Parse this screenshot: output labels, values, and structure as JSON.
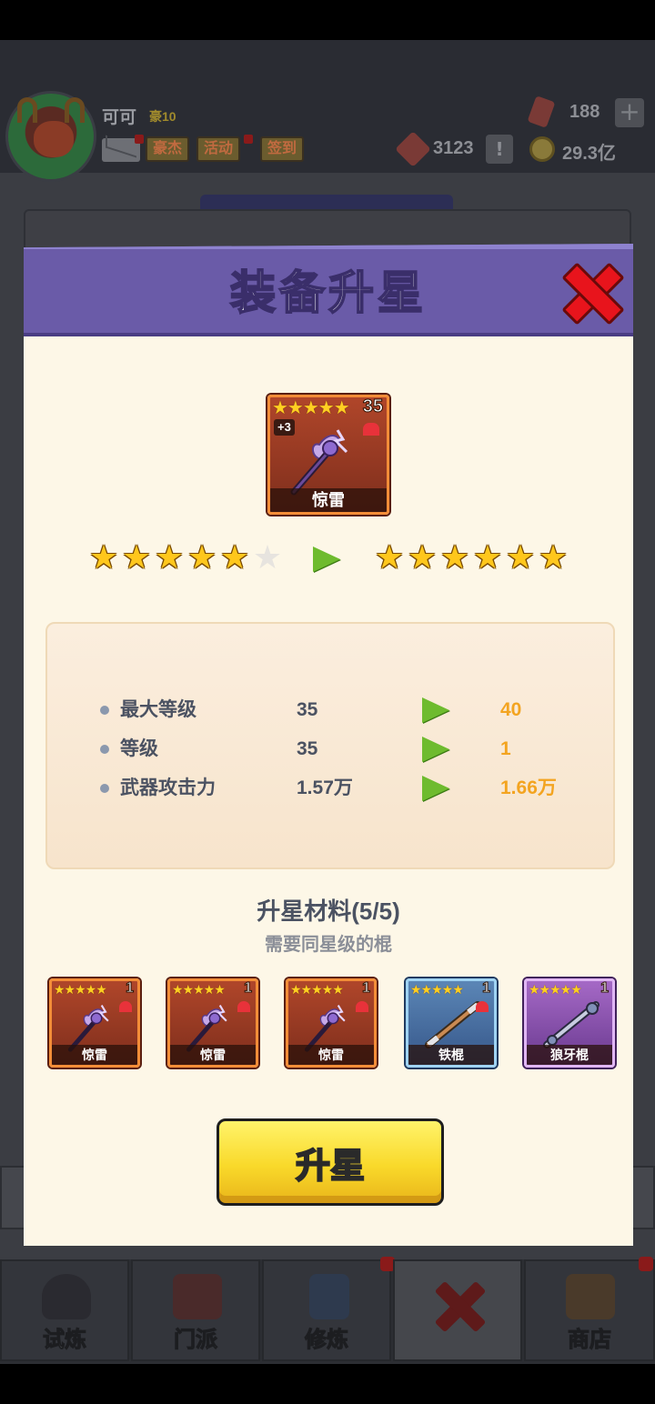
{
  "player": {
    "name": "可可",
    "rank": "豪10"
  },
  "top_buttons": [
    "豪杰",
    "活动",
    "签到"
  ],
  "resources": {
    "gems": "188",
    "tokens": "3123",
    "gold": "29.3亿"
  },
  "dialog": {
    "title": "装备升星",
    "main_item": {
      "name": "惊雷",
      "level": "35",
      "enhance": "+3",
      "stars": 5
    },
    "star_upgrade": {
      "from_stars": 5,
      "to_stars": 6,
      "max_stars": 6
    },
    "stats": [
      {
        "label": "最大等级",
        "current": "35",
        "next": "40"
      },
      {
        "label": "等级",
        "current": "35",
        "next": "1"
      },
      {
        "label": "武器攻击力",
        "current": "1.57万",
        "next": "1.66万"
      }
    ],
    "materials_title": "升星材料(5/5)",
    "materials_subtitle": "需要同星级的棍",
    "materials": [
      {
        "name": "惊雷",
        "level": "1",
        "rarity": "orange"
      },
      {
        "name": "惊雷",
        "level": "1",
        "rarity": "orange"
      },
      {
        "name": "惊雷",
        "level": "1",
        "rarity": "orange"
      },
      {
        "name": "铁棍",
        "level": "1",
        "rarity": "blue"
      },
      {
        "name": "狼牙棍",
        "level": "1",
        "rarity": "purple"
      }
    ],
    "upgrade_button": "升星"
  },
  "bottom_nav": [
    "试炼",
    "门派",
    "修炼",
    "",
    "商店"
  ],
  "colors": {
    "header": "#6a5ba8",
    "body": "#fdf7e7",
    "highlight": "#f3a420",
    "arrow": "#6ebb2e"
  }
}
